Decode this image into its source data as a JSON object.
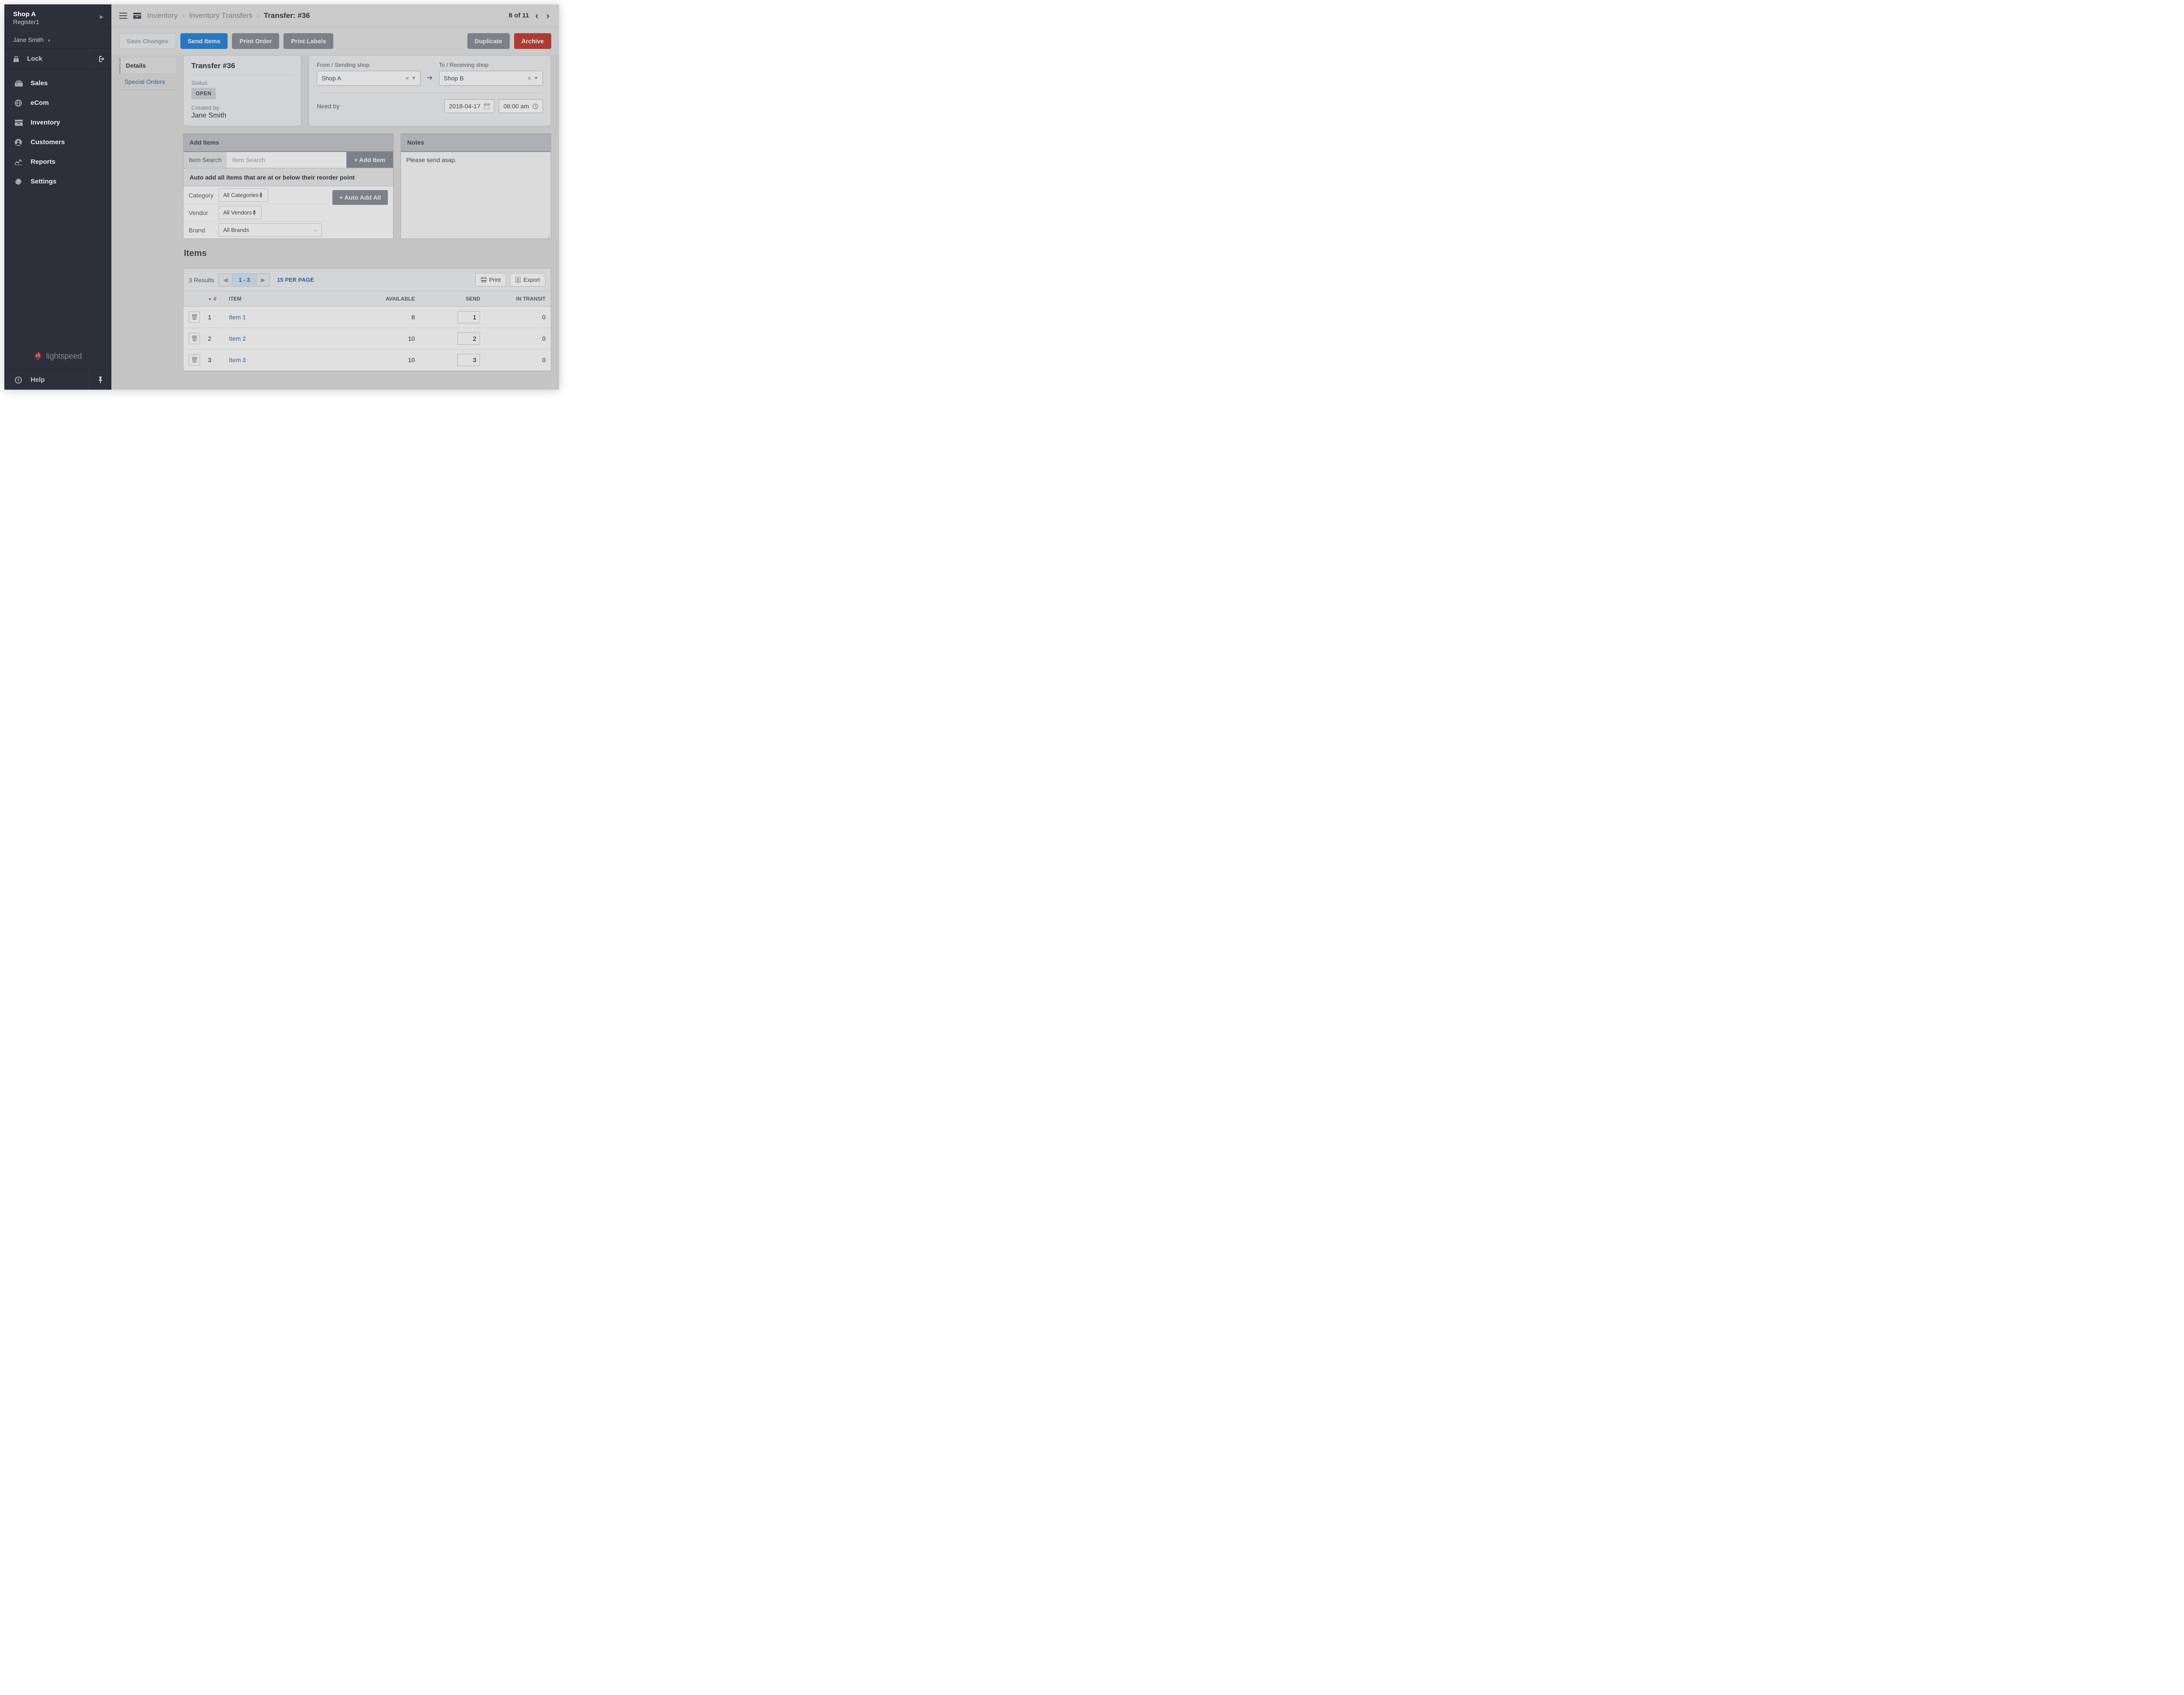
{
  "sidebar": {
    "shop": "Shop A",
    "register": "Register1",
    "user": "Jane Smith",
    "lock": "Lock",
    "nav": [
      {
        "label": "Sales",
        "icon": "sales"
      },
      {
        "label": "eCom",
        "icon": "globe"
      },
      {
        "label": "Inventory",
        "icon": "inventory"
      },
      {
        "label": "Customers",
        "icon": "user"
      },
      {
        "label": "Reports",
        "icon": "chart"
      },
      {
        "label": "Settings",
        "icon": "gear"
      }
    ],
    "logo": "lightspeed",
    "help": "Help"
  },
  "breadcrumb": {
    "part1": "Inventory",
    "part2": "Inventory Transfers",
    "current": "Transfer: #36",
    "pager": "8 of 11"
  },
  "toolbar": {
    "save": "Save Changes",
    "send": "Send Items",
    "print_order": "Print Order",
    "print_labels": "Print Labels",
    "duplicate": "Duplicate",
    "archive": "Archive"
  },
  "leftnav": {
    "details": "Details",
    "special": "Special Orders"
  },
  "transfer_card": {
    "title": "Transfer #36",
    "status_label": "Status",
    "status": "OPEN",
    "created_by_label": "Created by",
    "creator": "Jane Smith"
  },
  "shops": {
    "from_label": "From / Sending shop",
    "from_value": "Shop A",
    "to_label": "To / Receiving shop",
    "to_value": "Shop B",
    "need_label": "Need by",
    "need_date": "2018-04-17",
    "need_time": "08:00 am"
  },
  "add_items": {
    "header": "Add Items",
    "search_label": "Item Search",
    "search_placeholder": "Item Search",
    "add_btn": "+ Add Item",
    "auto_header": "Auto add all items that are at or below their reorder point",
    "category_label": "Category",
    "category_value": "All Categories",
    "vendor_label": "Vendor",
    "vendor_value": "All Vendors",
    "brand_label": "Brand",
    "brand_value": "All Brands",
    "auto_btn": "+ Auto Add All"
  },
  "notes": {
    "header": "Notes",
    "body": "Please send asap."
  },
  "items": {
    "title": "Items",
    "results": "3 Results",
    "page_range": "1 - 3",
    "per_page": "15 PER PAGE",
    "print": "Print",
    "export": "Export",
    "headers": {
      "num": "#",
      "item": "ITEM",
      "available": "AVAILABLE",
      "send": "SEND",
      "in_transit": "IN TRANSIT"
    },
    "rows": [
      {
        "num": "1",
        "name": "Item 1",
        "available": "8",
        "send": "1",
        "transit": "0"
      },
      {
        "num": "2",
        "name": "Item 2",
        "available": "10",
        "send": "2",
        "transit": "0"
      },
      {
        "num": "3",
        "name": "Item 3",
        "available": "10",
        "send": "3",
        "transit": "0"
      }
    ]
  }
}
